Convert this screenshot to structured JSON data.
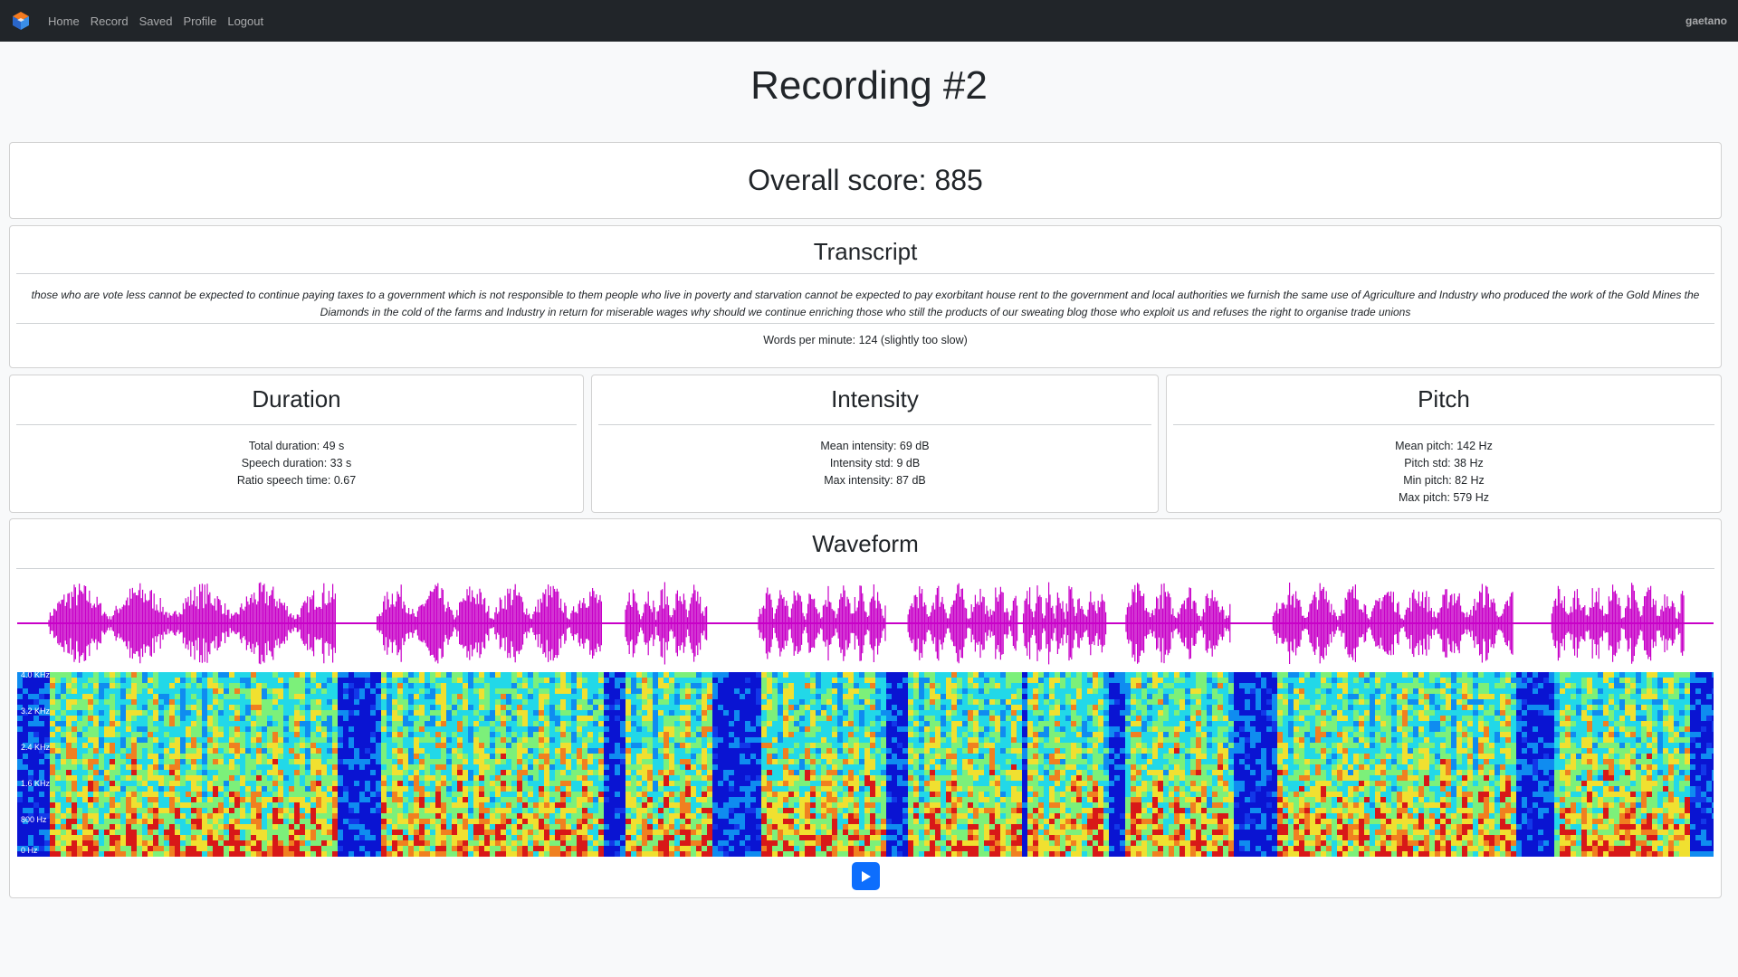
{
  "nav": {
    "items": [
      {
        "label": "Home"
      },
      {
        "label": "Record"
      },
      {
        "label": "Saved"
      },
      {
        "label": "Profile"
      },
      {
        "label": "Logout"
      }
    ],
    "user": "gaetano"
  },
  "page": {
    "title": "Recording #2"
  },
  "score": {
    "label": "Overall score: 885"
  },
  "transcript": {
    "heading": "Transcript",
    "text": "those who are vote less cannot be expected to continue paying taxes to a government which is not responsible to them people who live in poverty and starvation cannot be expected to pay exorbitant house rent to the government and local authorities we furnish the same use of Agriculture and Industry who produced the work of the Gold Mines the Diamonds in the cold of the farms and Industry in return for miserable wages why should we continue enriching those who still the products of our sweating blog those who exploit us and refuses the right to organise trade unions",
    "wpm": "Words per minute: 124 (slightly too slow)"
  },
  "duration": {
    "heading": "Duration",
    "lines": [
      "Total duration: 49 s",
      "Speech duration: 33 s",
      "Ratio speech time: 0.67"
    ]
  },
  "intensity": {
    "heading": "Intensity",
    "lines": [
      "Mean intensity: 69 dB",
      "Intensity std: 9 dB",
      "Max intensity: 87 dB"
    ]
  },
  "pitch": {
    "heading": "Pitch",
    "lines": [
      "Mean pitch: 142 Hz",
      "Pitch std: 38 Hz",
      "Min pitch: 82 Hz",
      "Max pitch: 579 Hz"
    ]
  },
  "waveform": {
    "heading": "Waveform",
    "spectrogram_labels": [
      "4.0 KHz",
      "3.2 KHz",
      "2.4 KHz",
      "1.6 KHz",
      "800 Hz",
      "0 Hz"
    ],
    "wave_color": "#c800c8",
    "play_icon": "play-icon"
  },
  "colors": {
    "navbar": "#212529",
    "accent": "#0d6efd",
    "spectrogram_background": "#0a14d2"
  }
}
